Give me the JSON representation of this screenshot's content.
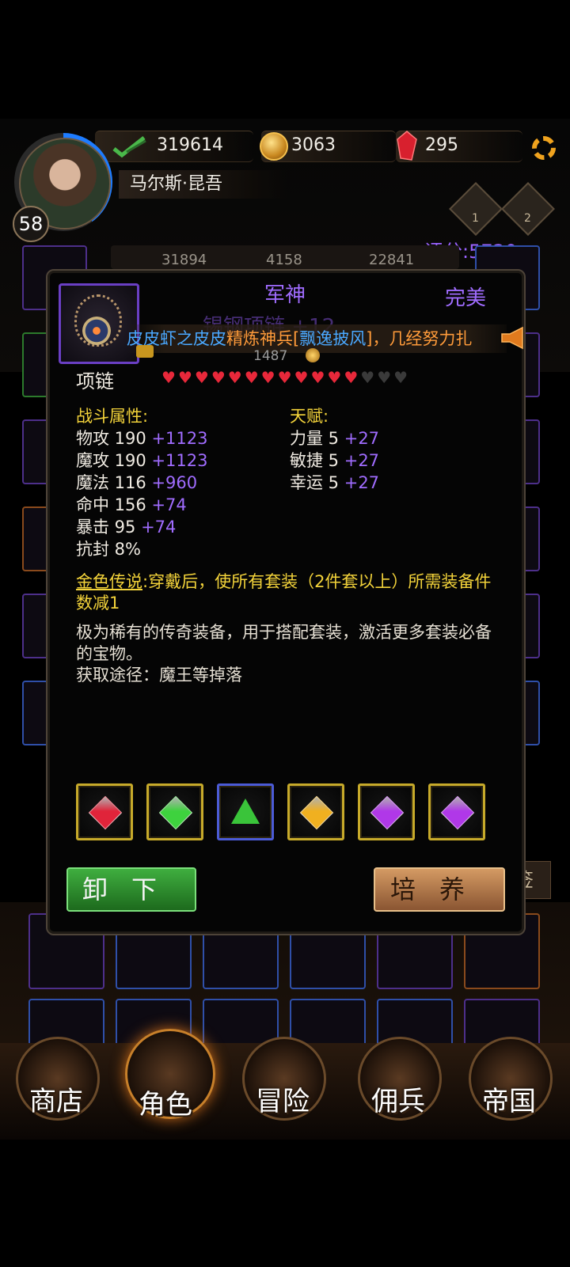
{
  "header": {
    "power": "319614",
    "gold": "3063",
    "gems": "295",
    "level": "58",
    "player_name": "马尔斯·昆吾",
    "rank_badges": [
      "1",
      "2"
    ],
    "score": "评分:5720",
    "bg_stats": [
      "31894",
      "4158",
      "22841"
    ],
    "icons": [
      "sword-check-icon",
      "gold-coin-icon",
      "red-gem-icon",
      "gear-icon"
    ]
  },
  "modal": {
    "title": "军神",
    "quality": "完美",
    "item_name_faded": "锡钢项链 +12",
    "broadcast": {
      "part1": "皮皮虾之皮皮",
      "part2": "精炼神兵[",
      "part3": "飘逸披风",
      "part4": "]，几经努力扎"
    },
    "price": "1487",
    "type": "项链",
    "stars_total": 15,
    "stars_filled": 12,
    "combat_title": "战斗属性:",
    "combat_stats": [
      {
        "label": "物攻 190",
        "bonus": "+1123"
      },
      {
        "label": "魔攻 190",
        "bonus": "+1123"
      },
      {
        "label": "魔法 116",
        "bonus": "+960"
      },
      {
        "label": "命中 156",
        "bonus": "+74"
      },
      {
        "label": "暴击 95",
        "bonus": "+74"
      },
      {
        "label": "抗封 8%",
        "bonus": ""
      }
    ],
    "talent_title": "天赋:",
    "talent_stats": [
      {
        "label": "力量 5",
        "bonus": "+27"
      },
      {
        "label": "敏捷 5",
        "bonus": "+27"
      },
      {
        "label": "幸运 5",
        "bonus": "+27"
      }
    ],
    "legend_label": "金色传说",
    "legend_text": ":穿戴后，使所有套装（2件套以上）所需装备件数减1",
    "description": "极为稀有的传奇装备，用于搭配套装，激活更多套装必备的宝物。",
    "source": "获取途径：魔王等掉落",
    "sockets": [
      {
        "gem": "red-gem-icon",
        "color": "#e0243a",
        "frame": "#c7aa2a"
      },
      {
        "gem": "green-gem-icon",
        "color": "#3ed23e",
        "frame": "#c7aa2a"
      },
      {
        "gem": "green-triangle-gem-icon",
        "color": "#3ac43a",
        "frame": "#4b5bd6"
      },
      {
        "gem": "yellow-gem-icon",
        "color": "#f0b020",
        "frame": "#c7aa2a"
      },
      {
        "gem": "purple-gem-icon",
        "color": "#b038e8",
        "frame": "#c7aa2a"
      },
      {
        "gem": "purple-gem-icon",
        "color": "#b038e8",
        "frame": "#c7aa2a"
      }
    ],
    "unequip_label": "卸下",
    "train_label": "培养"
  },
  "nav": [
    {
      "label": "商店",
      "icon": "castle-shop-icon"
    },
    {
      "label": "角色",
      "icon": "hooded-character-icon",
      "active": true
    },
    {
      "label": "冒险",
      "icon": "red-portal-icon"
    },
    {
      "label": "佣兵",
      "icon": "mercenary-cards-icon"
    },
    {
      "label": "帝国",
      "icon": "empire-banner-icon"
    }
  ],
  "side_tab_fragment": "签"
}
